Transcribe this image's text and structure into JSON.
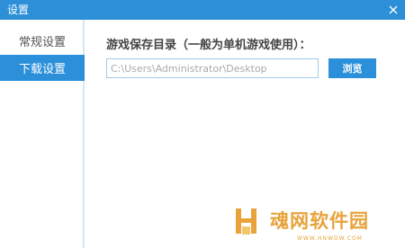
{
  "window": {
    "title": "设置",
    "close_icon": "close-icon"
  },
  "sidebar": {
    "items": [
      {
        "label": "常规设置",
        "active": false
      },
      {
        "label": "下载设置",
        "active": true
      }
    ]
  },
  "main": {
    "section_label": "游戏保存目录（一般为单机游戏使用）：",
    "path_value": "C:\\Users\\Administrator\\Desktop",
    "browse_label": "浏览"
  },
  "watermark": {
    "title": "魂网软件园",
    "url": "WWW.HNWDW.COM"
  },
  "colors": {
    "accent": "#2b8fd9",
    "titlebar": "#2c8fd7",
    "watermark": "#e8a33b"
  }
}
